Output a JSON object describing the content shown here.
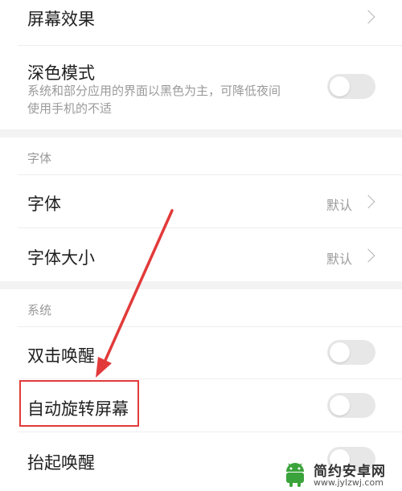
{
  "rows": {
    "screen_effect": {
      "title": "屏幕效果"
    },
    "dark_mode": {
      "title": "深色模式",
      "desc_line1": "系统和部分应用的界面以黑色为主，可降低夜间",
      "desc_line2": "使用手机的不适",
      "toggle_on": false
    },
    "font": {
      "title": "字体",
      "value": "默认"
    },
    "font_size": {
      "title": "字体大小",
      "value": "默认"
    },
    "double_tap_wake": {
      "title": "双击唤醒",
      "toggle_on": false
    },
    "auto_rotate": {
      "title": "自动旋转屏幕",
      "toggle_on": false
    },
    "raise_to_wake": {
      "title": "抬起唤醒",
      "toggle_on": false
    }
  },
  "sections": {
    "font": "字体",
    "system": "系统"
  },
  "annotation": {
    "color": "#e23a3a"
  },
  "watermark": {
    "title": "简约安卓网",
    "url": "www.jylzwj.com"
  }
}
